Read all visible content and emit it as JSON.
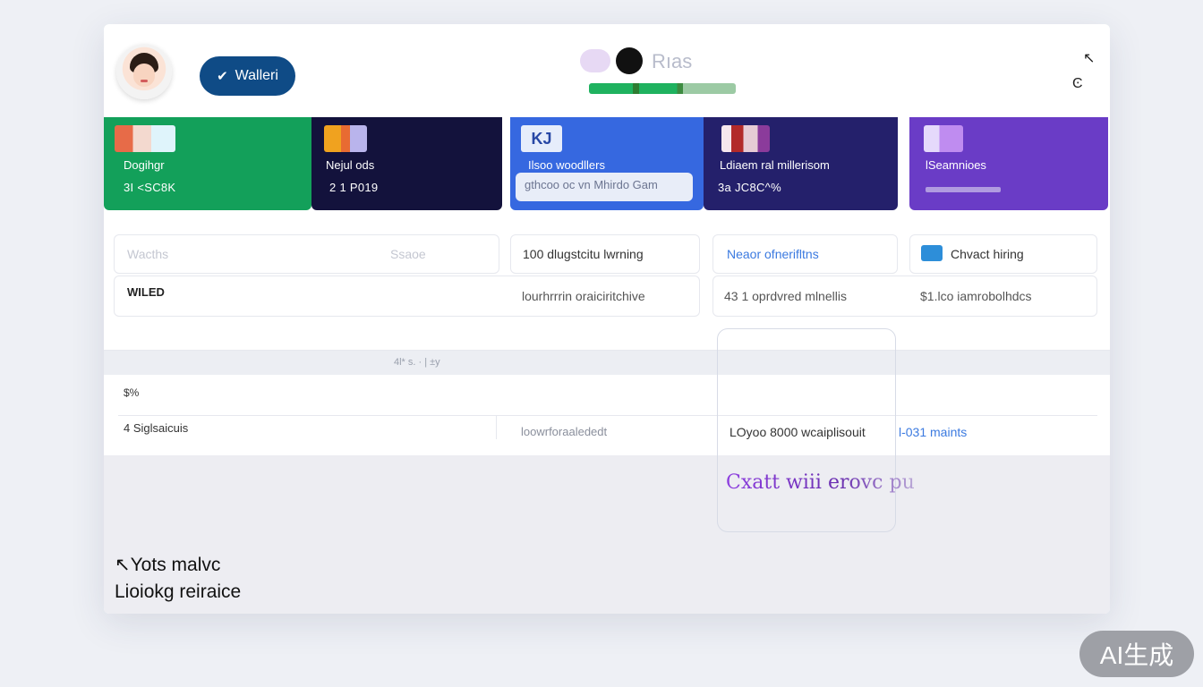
{
  "header": {
    "wallet_label": "Walleri",
    "brand_name": "Rıas",
    "icon_top": "↖",
    "icon_bottom": "Ͼ"
  },
  "cards": [
    {
      "label": "Dogihgr",
      "value": "3I <SC8K",
      "color": "#13a05a"
    },
    {
      "label": "Nejul ods",
      "value": "2 1 P019",
      "color": "#13123c"
    },
    {
      "label": "Ilsoo woodllers",
      "value": "",
      "search": "gthcoo oc vn  Mhirdo Gam",
      "color": "#3668e0"
    },
    {
      "label": "Ldiaem ral millerisom",
      "value": "3a   JC8C^%",
      "color": "#24206b"
    },
    {
      "label": "lSeamnioes",
      "value": "",
      "color": "#6a3cc6"
    }
  ],
  "filters": {
    "f1_left": "Wacths",
    "f1_right": "Ssaoe",
    "f2": "100 dlugstcitu lwrning",
    "f3": "Neaor ofnerifltns",
    "f4": "Chvact hiring"
  },
  "row1": {
    "label": "WILED",
    "c2": "lourhrrrin oraiciritchive",
    "c3": "43  1 oprdvred mlnellis",
    "c4": "$1.lco iamrobolhdcs"
  },
  "table": {
    "header_faint": "4l*   s.   ·   |  ±y",
    "row2_label": "$%",
    "row3_label": "4 Siglsaicuis",
    "row3_c2": "loowrforaalededt",
    "row3_c3": "LOyoo 8000  wcaiplisouit",
    "row3_link": "l-031 maints"
  },
  "chat": {
    "text": "Cxatt wiii erovc pu"
  },
  "footer": {
    "line1": "↖Yots malvc",
    "line2": "Lioiokg reiraice"
  },
  "badge": "AI生成"
}
